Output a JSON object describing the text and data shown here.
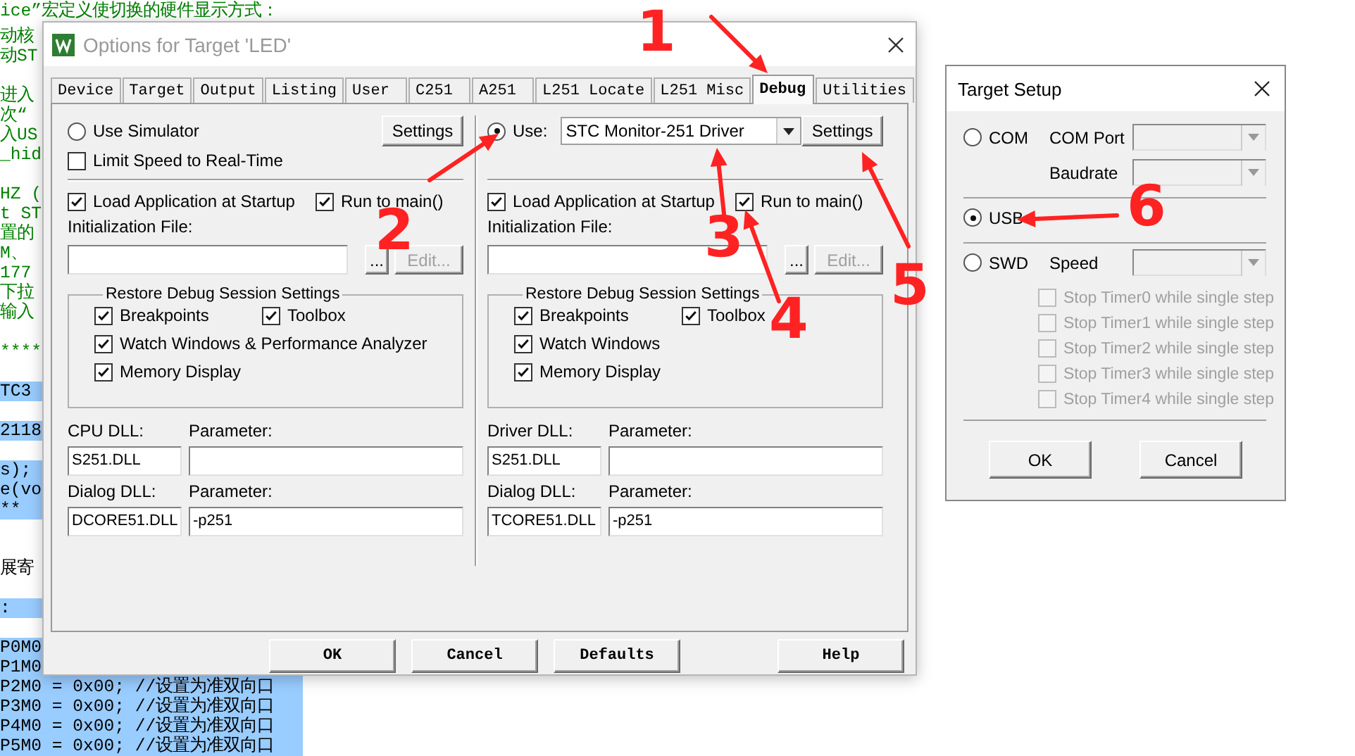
{
  "editor_lines": [
    {
      "text": "ice”宏定义使切换的硬件显示方式：",
      "kind": "comment",
      "highlighted": false
    },
    {
      "text": "动核",
      "kind": "comment",
      "highlighted": false
    },
    {
      "text": "动ST",
      "kind": "comment",
      "highlighted": false
    },
    {
      "text": "进入",
      "kind": "comment",
      "highlighted": false
    },
    {
      "text": "次“",
      "kind": "comment",
      "highlighted": false
    },
    {
      "text": "入US",
      "kind": "comment",
      "highlighted": false
    },
    {
      "text": "_hid",
      "kind": "comment",
      "highlighted": false
    },
    {
      "text": "HZ (",
      "kind": "comment",
      "highlighted": false
    },
    {
      "text": "t ST",
      "kind": "comment",
      "highlighted": false
    },
    {
      "text": "置的",
      "kind": "comment",
      "highlighted": false
    },
    {
      "text": "M、",
      "kind": "comment",
      "highlighted": false
    },
    {
      "text": "177",
      "kind": "comment",
      "highlighted": false
    },
    {
      "text": "下拉",
      "kind": "comment",
      "highlighted": false
    },
    {
      "text": "输入",
      "kind": "comment",
      "highlighted": false
    },
    {
      "text": "****",
      "kind": "comment",
      "highlighted": false
    },
    {
      "text": "TC3",
      "kind": "code",
      "highlighted": true
    },
    {
      "text": "2118",
      "kind": "code",
      "highlighted": true
    },
    {
      "text": "s);",
      "kind": "code",
      "highlighted": true
    },
    {
      "text": "e(vo",
      "kind": "code",
      "highlighted": true
    },
    {
      "text": "**",
      "kind": "code",
      "highlighted": true
    },
    {
      "text": "展寄",
      "kind": "code",
      "highlighted": false
    },
    {
      "text": ":",
      "kind": "code",
      "highlighted": true
    },
    {
      "text": "P0M0",
      "kind": "code",
      "highlighted": true
    },
    {
      "text": "P1M0",
      "kind": "code",
      "highlighted": true
    },
    {
      "text": "P2M0 = 0x00;   //设置为准双向口",
      "kind": "code",
      "highlighted": true
    },
    {
      "text": "P3M0 = 0x00;   //设置为准双向口",
      "kind": "code",
      "highlighted": true
    },
    {
      "text": "P4M0 = 0x00;   //设置为准双向口",
      "kind": "code",
      "highlighted": true
    },
    {
      "text": "P5M0 = 0x00;   //设置为准双向口",
      "kind": "code",
      "highlighted": true
    }
  ],
  "options_dialog": {
    "title": "Options for Target 'LED'",
    "tabs": [
      {
        "label": "Device",
        "selected": false
      },
      {
        "label": "Target",
        "selected": false
      },
      {
        "label": "Output",
        "selected": false
      },
      {
        "label": "Listing",
        "selected": false
      },
      {
        "label": "User",
        "selected": false
      },
      {
        "label": "C251",
        "selected": false
      },
      {
        "label": "A251",
        "selected": false
      },
      {
        "label": "L251 Locate",
        "selected": false
      },
      {
        "label": "L251 Misc",
        "selected": false
      },
      {
        "label": "Debug",
        "selected": true
      },
      {
        "label": "Utilities",
        "selected": false
      }
    ],
    "panes": [
      {
        "mode": {
          "label": "Use Simulator",
          "selected": false
        },
        "settings_button": "Settings",
        "limit_speed": {
          "label": "Limit Speed to Real-Time",
          "checked": false
        },
        "load_app": {
          "label": "Load Application at Startup",
          "checked": true
        },
        "run_to_main": {
          "label": "Run to main()",
          "checked": true
        },
        "init_file_label": "Initialization File:",
        "browse_button": "...",
        "edit_button": {
          "label": "Edit...",
          "disabled": true
        },
        "restore_group": {
          "title": "Restore Debug Session Settings",
          "options": [
            {
              "label": "Breakpoints",
              "checked": true
            },
            {
              "label": "Toolbox",
              "checked": true
            },
            {
              "label": "Watch Windows & Performance Analyzer",
              "checked": true
            },
            {
              "label": "Memory Display",
              "checked": true
            }
          ]
        },
        "dll_rows": [
          {
            "label": "CPU DLL:",
            "value": "S251.DLL",
            "param_label": "Parameter:"
          },
          {
            "label": "Dialog DLL:",
            "value": "DCORE51.DLL",
            "param_label": "Parameter:",
            "param_value": "-p251"
          }
        ]
      },
      {
        "mode": {
          "label": "Use:",
          "selected": true
        },
        "driver": "STC Monitor-251 Driver",
        "settings_button": "Settings",
        "load_app": {
          "label": "Load Application at Startup",
          "checked": true
        },
        "run_to_main": {
          "label": "Run to main()",
          "checked": true
        },
        "init_file_label": "Initialization File:",
        "browse_button": "...",
        "edit_button": {
          "label": "Edit...",
          "disabled": true
        },
        "restore_group": {
          "title": "Restore Debug Session Settings",
          "options": [
            {
              "label": "Breakpoints",
              "checked": true
            },
            {
              "label": "Toolbox",
              "checked": true
            },
            {
              "label": "Watch Windows",
              "checked": true
            },
            {
              "label": "Memory Display",
              "checked": true
            }
          ]
        },
        "dll_rows": [
          {
            "label": "Driver DLL:",
            "value": "S251.DLL",
            "param_label": "Parameter:"
          },
          {
            "label": "Dialog DLL:",
            "value": "TCORE51.DLL",
            "param_label": "Parameter:",
            "param_value": "-p251"
          }
        ]
      }
    ],
    "buttons": [
      "OK",
      "Cancel",
      "Defaults",
      "Help"
    ]
  },
  "target_setup": {
    "title": "Target Setup",
    "connections": [
      {
        "label": "COM",
        "selected": false,
        "fields": [
          "COM Port",
          "Baudrate"
        ]
      },
      {
        "label": "USB",
        "selected": true
      },
      {
        "label": "SWD",
        "selected": false,
        "fields": [
          "Speed"
        ]
      }
    ],
    "stop_options": [
      {
        "label": "Stop Timer0 while single step",
        "checked": false,
        "disabled": true
      },
      {
        "label": "Stop Timer1 while single step",
        "checked": false,
        "disabled": true
      },
      {
        "label": "Stop Timer2 while single step",
        "checked": false,
        "disabled": true
      },
      {
        "label": "Stop Timer3 while single step",
        "checked": false,
        "disabled": true
      },
      {
        "label": "Stop Timer4 while single step",
        "checked": false,
        "disabled": true
      }
    ],
    "buttons": [
      "OK",
      "Cancel"
    ]
  },
  "annotation_marks": [
    "1",
    "2",
    "3",
    "4",
    "5",
    "6"
  ]
}
